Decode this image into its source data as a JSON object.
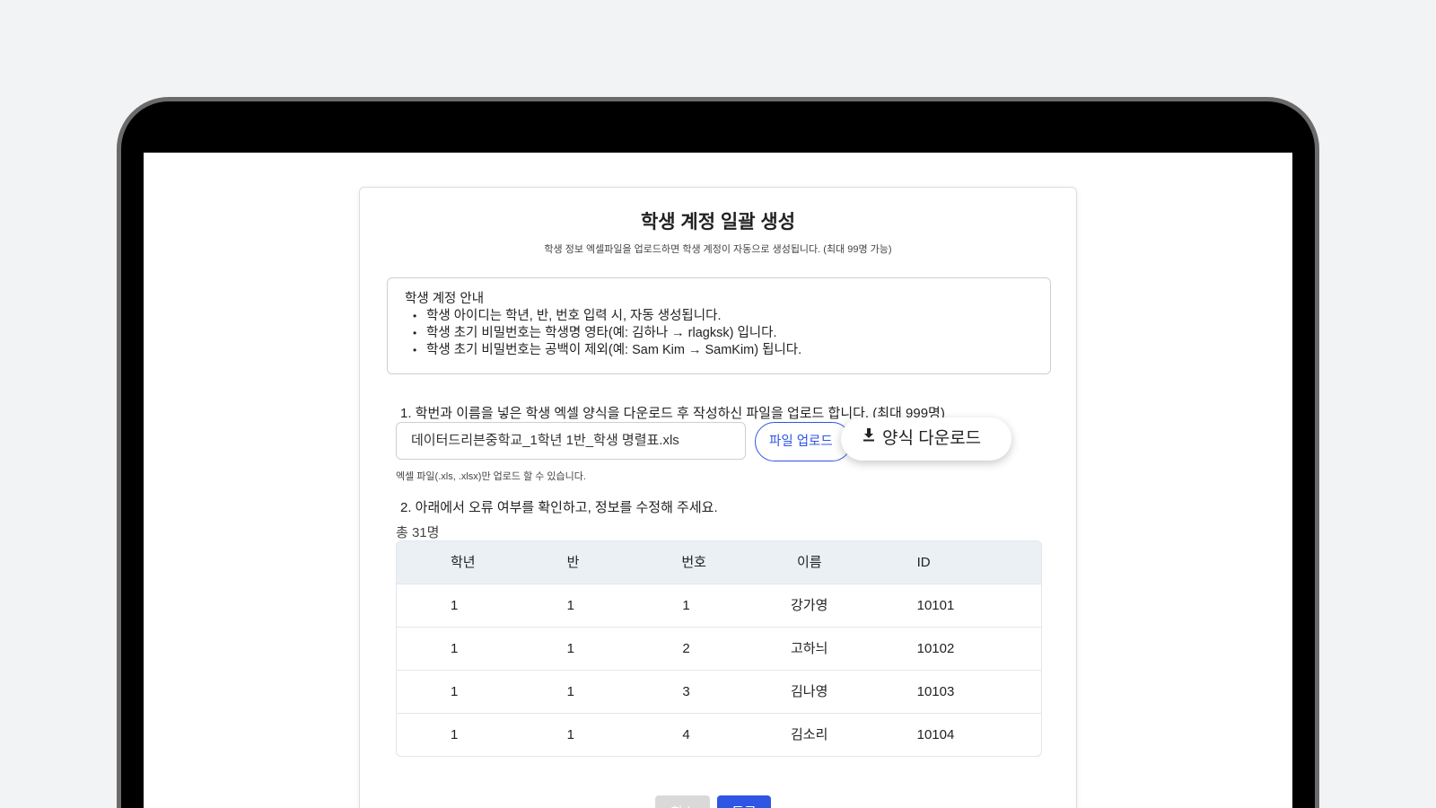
{
  "dialog": {
    "title": "학생 계정 일괄 생성",
    "subtitle": "학생 정보 엑셀파일을 업로드하면 학생 계정이 자동으로 생성됩니다. (최대 99명 가능)"
  },
  "guide": {
    "heading": "학생 계정 안내",
    "items": [
      "학생 아이디는 학년, 반, 번호 입력 시, 자동 생성됩니다.",
      "학생 초기 비밀번호는 학생명 영타(예: 김하나 → rlagksk) 입니다.",
      "학생 초기 비밀번호는 공백이 제외(예: Sam Kim → SamKim) 됩니다."
    ]
  },
  "step1": {
    "label": "1. 학번과 이름을 넣은 학생 엑셀 양식을 다운로드 후 작성하신 파일을 업로드 합니다. (최대 999명)",
    "file_value": "데이터드리븐중학교_1학년 1반_학생 명렬표.xls",
    "upload_button": "파일 업로드",
    "download_button": "양식 다운로드",
    "download_icon": "download-icon",
    "hint": "엑셀 파일(.xls, .xlsx)만 업로드 할 수 있습니다."
  },
  "step2": {
    "label": "2. 아래에서 오류 여부를 확인하고, 정보를 수정해 주세요.",
    "total": "총 31명"
  },
  "table": {
    "headers": [
      "학년",
      "반",
      "번호",
      "이름",
      "ID"
    ],
    "rows": [
      [
        "1",
        "1",
        "1",
        "강가영",
        "10101"
      ],
      [
        "1",
        "1",
        "2",
        "고하늬",
        "10102"
      ],
      [
        "1",
        "1",
        "3",
        "김나영",
        "10103"
      ],
      [
        "1",
        "1",
        "4",
        "김소리",
        "10104"
      ]
    ]
  },
  "actions": {
    "cancel": "취소",
    "submit": "등록"
  },
  "colors": {
    "accent": "#2f55e4",
    "disabled": "#d9d9d9",
    "table_header_bg": "#ebf0f4"
  }
}
